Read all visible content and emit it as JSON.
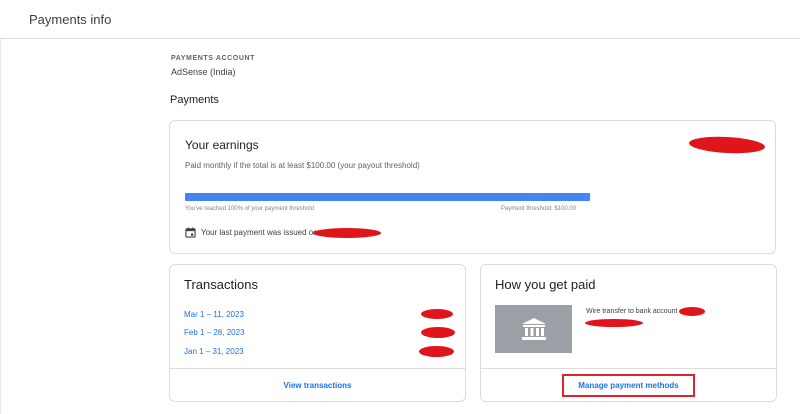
{
  "topbar": {
    "title": "Payments info"
  },
  "account": {
    "label": "PAYMENTS ACCOUNT",
    "value": "AdSense (India)"
  },
  "payments_section": {
    "title": "Payments"
  },
  "earnings": {
    "heading": "Your earnings",
    "description": "Paid monthly if the total is at least $100.00 (your payout threshold)",
    "progress_percent": 100,
    "progress_left_text": "You've reached 100% of your payment threshold",
    "progress_right_text": "Payment threshold: $100.00",
    "last_payment_text": "Your last payment was issued on",
    "icon": "calendar-icon",
    "accent_color": "#4285f4"
  },
  "transactions": {
    "title": "Transactions",
    "rows": [
      {
        "date": "Mar 1 – 11, 2023"
      },
      {
        "date": "Feb 1 – 28, 2023"
      },
      {
        "date": "Jan 1 – 31, 2023"
      }
    ],
    "footer_link": "View transactions"
  },
  "how_you_get_paid": {
    "title": "How you get paid",
    "method_text": "Wire transfer to bank account",
    "icon": "bank-icon",
    "footer_link": "Manage payment methods",
    "highlight_color": "#d9252b"
  },
  "redaction_color": "#e0141b"
}
